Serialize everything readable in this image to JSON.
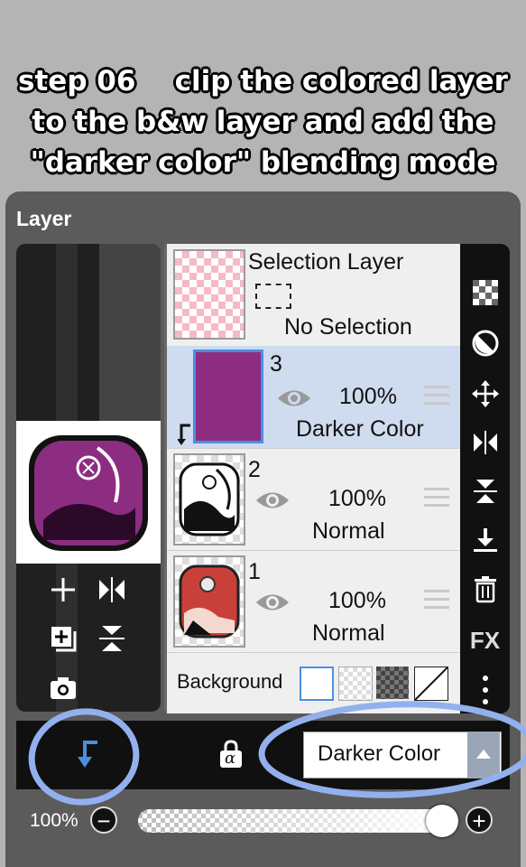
{
  "caption": {
    "line1": "step 06    clip the colored layer",
    "line2": "to the b&w layer and add the",
    "line3": "\"darker color\" blending mode"
  },
  "panel": {
    "title": "Layer"
  },
  "selection_layer": {
    "title": "Selection Layer",
    "status": "No Selection"
  },
  "layers": [
    {
      "number": "3",
      "opacity": "100%",
      "blend": "Darker Color",
      "selected": true,
      "clipped": true
    },
    {
      "number": "2",
      "opacity": "100%",
      "blend": "Normal"
    },
    {
      "number": "1",
      "opacity": "100%",
      "blend": "Normal"
    }
  ],
  "background": {
    "label": "Background"
  },
  "blend_select": {
    "value": "Darker Color"
  },
  "opacity": {
    "label": "100%",
    "value": 1.0
  },
  "colors": {
    "accent": "#4a8fe0",
    "selected_row": "#cfdbee",
    "layer3_fill": "#8c2d82",
    "annotation": "#93b0ee"
  },
  "icons": {
    "left_tools": [
      "plus-icon",
      "flip-horizontal-icon",
      "merge-copy-icon",
      "flip-vertical-icon",
      "camera-icon"
    ],
    "right_tools": [
      "checker-icon",
      "mask-icon",
      "move-icon",
      "flip-horizontal-icon",
      "flip-vertical-icon",
      "merge-down-icon",
      "trash-icon",
      "fx-icon",
      "more-icon"
    ]
  },
  "right_tools_fx": "FX",
  "lock_alpha": "α"
}
